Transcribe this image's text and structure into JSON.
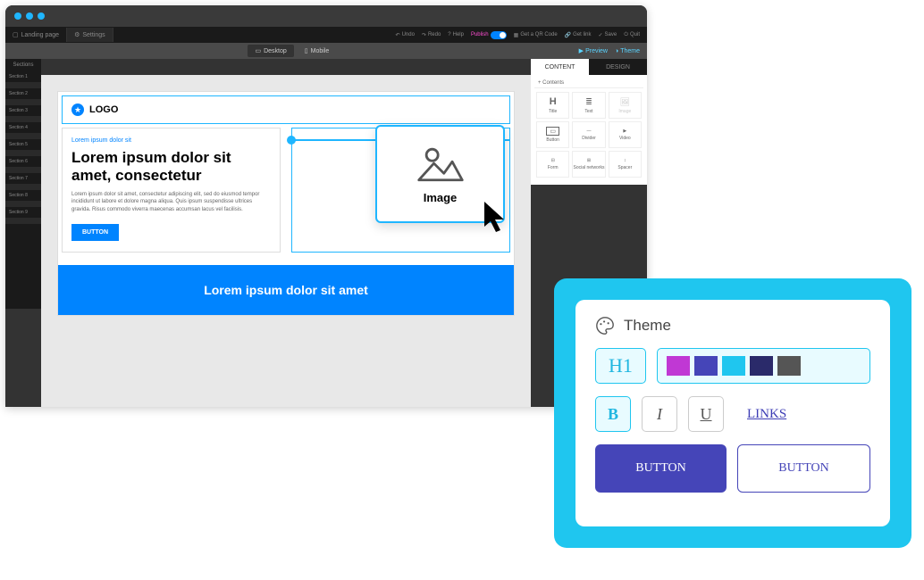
{
  "menu": {
    "landing_page": "Landing page",
    "settings": "Settings",
    "undo": "Undo",
    "redo": "Redo",
    "help": "Help",
    "publish": "Publish",
    "qr": "Get a QR Code",
    "link": "Get link",
    "save": "Save",
    "quit": "Quit"
  },
  "viewbar": {
    "desktop": "Desktop",
    "mobile": "Mobile",
    "preview": "Preview",
    "theme": "Theme"
  },
  "right_tabs": {
    "content": "CONTENT",
    "design": "DESIGN"
  },
  "contents": {
    "header": "+ Contents",
    "items": [
      "Title",
      "Text",
      "Image",
      "Button",
      "Divider",
      "Video",
      "Form",
      "Social networks",
      "Spacer"
    ]
  },
  "sections": {
    "title": "Sections",
    "items": [
      "Section 1",
      "Section 2",
      "Section 3",
      "Section 4",
      "Section 5",
      "Section 6",
      "Section 7",
      "Section 8",
      "Section 9"
    ]
  },
  "page": {
    "logo": "LOGO",
    "box_label": "Lorem ipsum dolor sit",
    "box_title": "Lorem ipsum dolor sit amet, consectetur",
    "box_body": "Lorem ipsum dolor sit amet, consectetur adipiscing elit, sed do eiusmod tempor incididunt ut labore et dolore magna aliqua. Quis ipsum suspendisse ultrices gravida. Risus commodo viverra maecenas accumsan lacus vel facilisis.",
    "button": "BUTTON",
    "blue_section": "Lorem ipsum dolor sit amet"
  },
  "drag": {
    "label": "Image"
  },
  "theme": {
    "title": "Theme",
    "h1": "H1",
    "palette": [
      "#c038d4",
      "#4545b8",
      "#1fc6ef",
      "#2a2a6a",
      "#555555"
    ],
    "bold": "B",
    "italic": "I",
    "underline": "U",
    "links": "LINKS",
    "button_filled": "BUTTON",
    "button_outlined": "BUTTON"
  }
}
